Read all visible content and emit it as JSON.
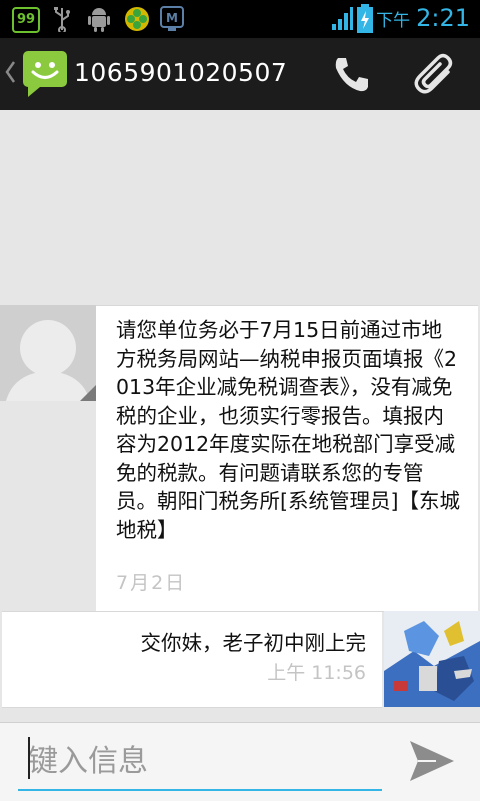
{
  "status_bar": {
    "notification_badge": "99",
    "icons": [
      "usb-icon",
      "android-debug-icon",
      "clover-app-icon",
      "monitor-app-icon",
      "signal-icon",
      "battery-charging-icon"
    ],
    "time_ampm": "下午",
    "time": "2:21",
    "accent_color": "#33b5e5"
  },
  "action_bar": {
    "title": "1065901020507",
    "icons": [
      "back-chevron-icon",
      "messaging-app-icon",
      "phone-icon",
      "attachment-icon"
    ]
  },
  "messages": [
    {
      "direction": "incoming",
      "text": "请您单位务必于7月15日前通过市地方税务局网站—纳税申报页面填报《2013年企业减免税调查表》，没有减免税的企业，也须实行零报告。填报内容为2012年度实际在地税部门享受减免的税款。有问题请联系您的专管员。朝阳门税务所[系统管理员]【东城地税】",
      "timestamp": "7月2日",
      "avatar": "default-contact-avatar-icon"
    },
    {
      "direction": "outgoing",
      "text": "交你妹，老子初中刚上完",
      "timestamp": "上午 11:56",
      "avatar": "user-photo-avatar"
    }
  ],
  "compose": {
    "placeholder": "键入信息",
    "send_icon": "send-icon"
  }
}
